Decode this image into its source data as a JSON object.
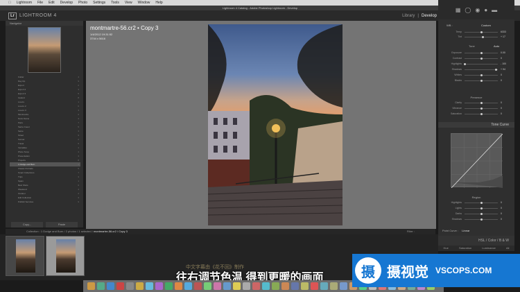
{
  "menubar": {
    "app": "Lightroom",
    "items": [
      "File",
      "Edit",
      "Develop",
      "Photo",
      "Settings",
      "Tools",
      "View",
      "Window",
      "Help"
    ]
  },
  "window_title": "Lightroom 4 Catalog - Adobe Photoshop Lightroom - Develop",
  "identity": {
    "logo": "Lr",
    "title": "LIGHTROOM 4"
  },
  "modules": {
    "library": "Library",
    "separator": "|",
    "develop": "Develop"
  },
  "navigator": {
    "label": "Navigator"
  },
  "folders": [
    {
      "label": "Folder",
      "count": "4"
    },
    {
      "label": "Day trip",
      "count": "9"
    },
    {
      "label": "Export",
      "count": "2"
    },
    {
      "label": "Export 2",
      "count": "3"
    },
    {
      "label": "Export 3",
      "count": "5"
    },
    {
      "label": "Iceland",
      "count": "8"
    },
    {
      "label": "Louvre",
      "count": "1"
    },
    {
      "label": "Louvre 2",
      "count": "6"
    },
    {
      "label": "Louvre 3",
      "count": "3"
    },
    {
      "label": "Montmartre",
      "count": "2"
    },
    {
      "label": "Notre Dame",
      "count": "4"
    },
    {
      "label": "Paris",
      "count": "7"
    },
    {
      "label": "Sacre Coeur",
      "count": "5"
    },
    {
      "label": "Seine",
      "count": "3"
    },
    {
      "label": "Street",
      "count": "9"
    },
    {
      "label": "Sunset",
      "count": "2"
    },
    {
      "label": "Travel",
      "count": "6"
    },
    {
      "label": "Versailles",
      "count": "1"
    },
    {
      "label": "Photo Temp",
      "count": "4"
    },
    {
      "label": "Presentation",
      "count": "3"
    },
    {
      "label": "Projects",
      "count": "8"
    },
    {
      "label": "1 Dodge and Burn",
      "count": "2"
    },
    {
      "label": "Classic Portraits",
      "count": "5"
    },
    {
      "label": "Smart Collections",
      "count": "7"
    },
    {
      "label": "Trips",
      "count": "3"
    },
    {
      "label": "Spain",
      "count": "1"
    },
    {
      "label": "Best Shots",
      "count": "6"
    },
    {
      "label": "Weekend",
      "count": "4"
    },
    {
      "label": "Outdoor",
      "count": "2"
    },
    {
      "label": "Edit Collection",
      "count": "3"
    },
    {
      "label": "Publish Services",
      "count": "9"
    }
  ],
  "left_buttons": {
    "import": "Copy...",
    "paste": "Paste"
  },
  "photo": {
    "filename": "montmartre-56.cr2",
    "copy": "Copy 3",
    "meta_line1": "1/4/2012 19:31:52",
    "meta_line2": "3744 x 5616"
  },
  "right_panel": {
    "wb_label": "WB :",
    "wb_value": "Custom",
    "sliders_basic": [
      {
        "label": "Temp",
        "value": "6333",
        "pos": 0.52
      },
      {
        "label": "Tint",
        "value": "+ 17",
        "pos": 0.56
      }
    ],
    "tone_label": "Tone",
    "auto_label": "Auto",
    "sliders_tone": [
      {
        "label": "Exposure",
        "value": "0.00",
        "pos": 0.5
      },
      {
        "label": "Contrast",
        "value": "0",
        "pos": 0.5
      },
      {
        "label": "Highlights",
        "value": "- 100",
        "pos": 0.02
      },
      {
        "label": "Shadows",
        "value": "+ 94",
        "pos": 0.95
      },
      {
        "label": "Whites",
        "value": "0",
        "pos": 0.5
      },
      {
        "label": "Blacks",
        "value": "0",
        "pos": 0.5
      }
    ],
    "presence_label": "Presence",
    "sliders_presence": [
      {
        "label": "Clarity",
        "value": "0",
        "pos": 0.5
      },
      {
        "label": "Vibrance",
        "value": "0",
        "pos": 0.5
      },
      {
        "label": "Saturation",
        "value": "0",
        "pos": 0.5
      }
    ],
    "tone_curve_label": "Tone Curve",
    "region_label": "Region",
    "sliders_region": [
      {
        "label": "Highlights",
        "value": "0",
        "pos": 0.5
      },
      {
        "label": "Lights",
        "value": "0",
        "pos": 0.5
      },
      {
        "label": "Darks",
        "value": "0",
        "pos": 0.5
      },
      {
        "label": "Shadows",
        "value": "0",
        "pos": 0.5
      }
    ],
    "point_curve_label": "Point Curve :",
    "point_curve_value": "Linear",
    "hsl_head": "HSL / Color / B & W",
    "hsl_tabs": [
      "Hue",
      "Saturation",
      "Luminance",
      "All"
    ]
  },
  "filmstrip": {
    "path_prefix": "Collection : 1 Dodge and Burn / 2 photos / 1 selected /",
    "path_file": "montmartre-56.cr2 / Copy 3",
    "filter_label": "Filter :"
  },
  "subtitle_faint": "中文字幕由《花不回》制作",
  "subtitle": "往右调节色温 得到更暖的画面",
  "watermark": {
    "logo_char": "摄",
    "cn": "摄视觉",
    "en": "VSCOPS.COM"
  },
  "colors": {
    "accent_watermark": "#1677d2",
    "panel_bg": "#2f2f2f",
    "canvas_bg": "#747474"
  }
}
